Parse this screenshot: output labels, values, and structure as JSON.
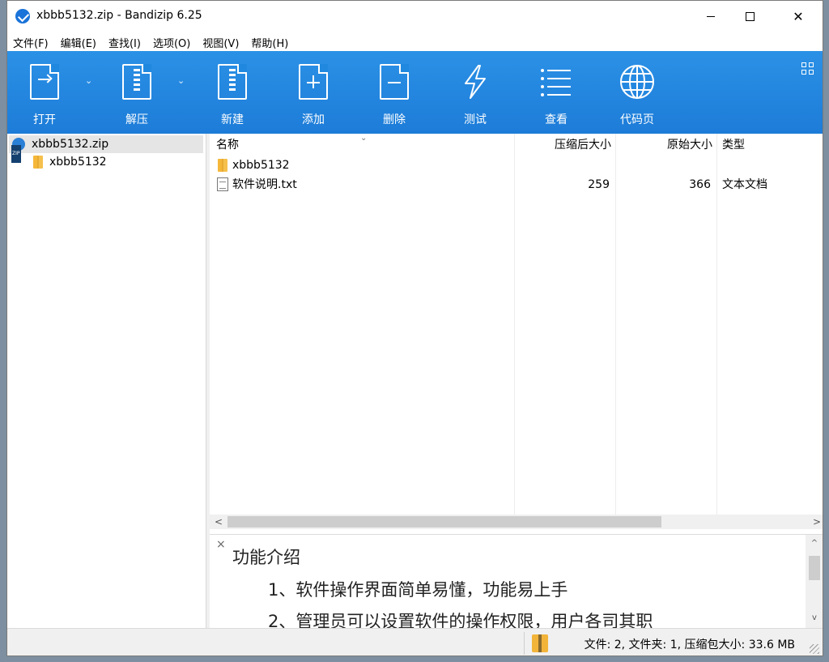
{
  "window": {
    "title": "xbbb5132.zip - Bandizip 6.25",
    "minimize": "—",
    "maximize": "☐",
    "close": "✕"
  },
  "menu": [
    "文件(F)",
    "编辑(E)",
    "查找(I)",
    "选项(O)",
    "视图(V)",
    "帮助(H)"
  ],
  "toolbar": {
    "open": "打开",
    "extract": "解压",
    "new": "新建",
    "add": "添加",
    "delete": "删除",
    "test": "测试",
    "view": "查看",
    "codepage": "代码页",
    "dropdown": "⌄"
  },
  "tree": {
    "archive": "xbbb5132.zip",
    "folder": "xbbb5132"
  },
  "columns": {
    "name": "名称",
    "compressed": "压缩后大小",
    "original": "原始大小",
    "type": "类型"
  },
  "files": [
    {
      "name": "xbbb5132",
      "compressed": "",
      "original": "",
      "type": ""
    },
    {
      "name": "软件说明.txt",
      "compressed": "259",
      "original": "366",
      "type": "文本文档"
    }
  ],
  "scroll": {
    "left": "<",
    "right": ">",
    "up": "^",
    "down": "v"
  },
  "info": {
    "close": "×",
    "title": "功能介绍",
    "lines": [
      "1、软件操作界面简单易懂，功能易上手",
      "2、管理员可以设置软件的操作权限，用户各司其职"
    ]
  },
  "status": {
    "text": "文件: 2, 文件夹: 1, 压缩包大小: 33.6 MB"
  },
  "colors": {
    "toolbar": "#1d7cd8",
    "selection": "#e5e5e5"
  },
  "icons": [
    "app-icon",
    "open-icon",
    "extract-icon",
    "new-icon",
    "add-icon",
    "delete-icon",
    "test-icon",
    "view-icon",
    "codepage-icon",
    "layout-icon",
    "zip-icon",
    "folder-icon",
    "text-file-icon"
  ]
}
